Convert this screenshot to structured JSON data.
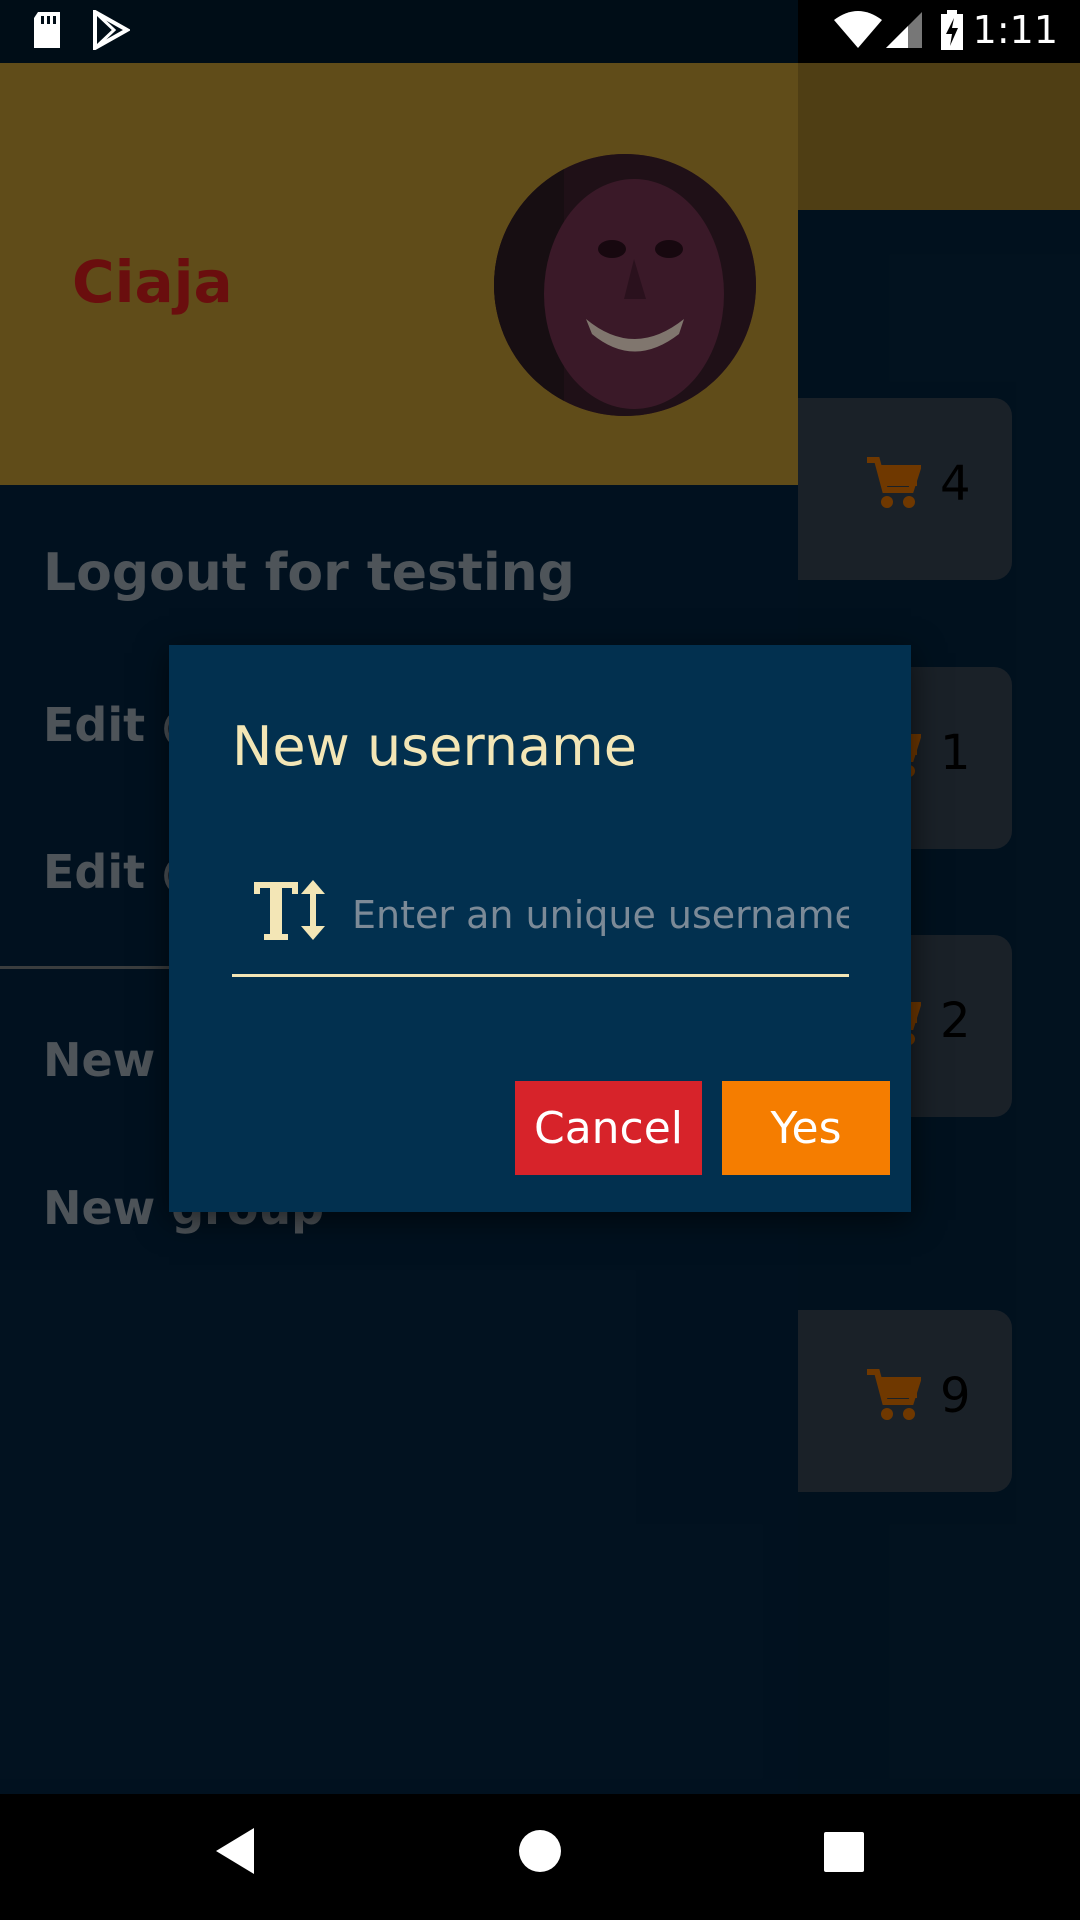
{
  "status_bar": {
    "time": "1:11",
    "icons": [
      "sd-card-icon",
      "play-store-icon",
      "wifi-icon",
      "signal-icon",
      "battery-charging-icon"
    ]
  },
  "drawer": {
    "user_name": "Ciaja",
    "avatar_icon": "user-avatar",
    "menu_items": [
      {
        "label": "Logout for testing"
      },
      {
        "label": "Edit @"
      },
      {
        "label": "Edit @"
      },
      {
        "label": "New p"
      },
      {
        "label": "New group"
      }
    ]
  },
  "background_cards": [
    {
      "count": "4"
    },
    {
      "count": "1"
    },
    {
      "count": "2"
    },
    {
      "count": "9"
    }
  ],
  "dialog": {
    "title": "New username",
    "input_placeholder": "Enter an unique username",
    "input_value": "",
    "input_icon": "text-size-icon",
    "cancel_label": "Cancel",
    "yes_label": "Yes"
  },
  "nav_bar": {
    "icons": [
      "back-icon",
      "home-icon",
      "recents-icon"
    ]
  },
  "colors": {
    "header_gold": "#b08a2e",
    "drawer_navy": "#03203a",
    "dialog_navy": "#02304f",
    "accent_cream": "#f3e6b6",
    "cancel_red": "#d7232a",
    "yes_orange": "#f57d00",
    "name_red": "#c21b1b"
  }
}
